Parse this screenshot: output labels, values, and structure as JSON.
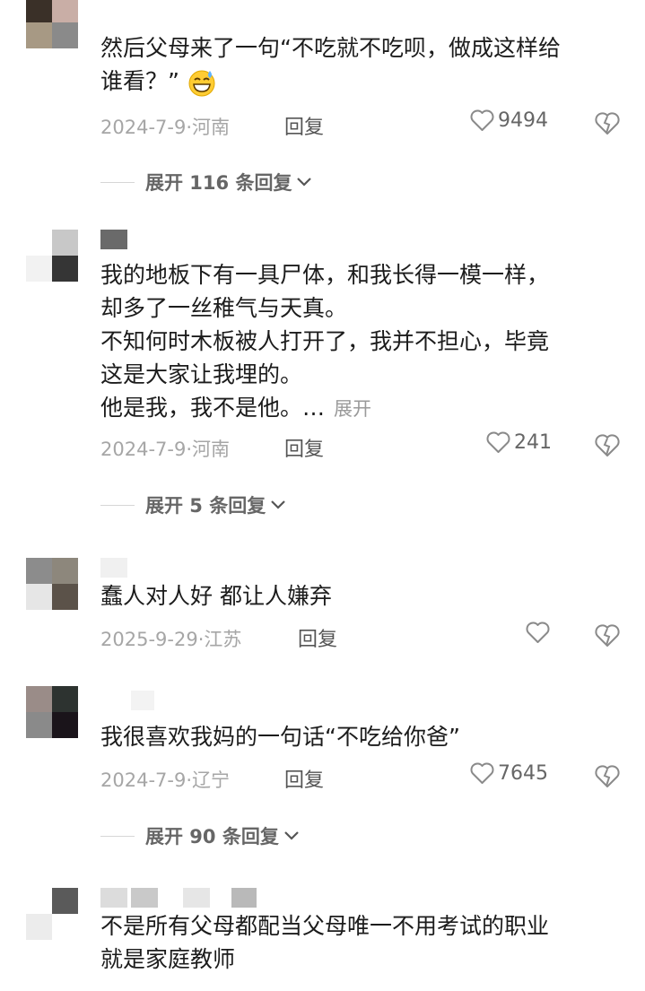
{
  "comments": [
    {
      "text_lines": [
        "然后父母来了一句“不吃就不吃呗，做成这样给",
        "谁看？”"
      ],
      "has_emoji": true,
      "date": "2024-7-9",
      "location": "河南",
      "reply_label": "回复",
      "likes": "9494",
      "replies_label": "展开 116 条回复"
    },
    {
      "text_lines": [
        "我的地板下有一具尸体，和我长得一模一样，",
        "却多了一丝稚气与天真。",
        "不知何时木板被人打开了，我并不担心，毕竟",
        "这是大家让我埋的。",
        "他是我，我不是他。…"
      ],
      "expand_label": "展开",
      "date": "2024-7-9",
      "location": "河南",
      "reply_label": "回复",
      "likes": "241",
      "replies_label": "展开 5 条回复"
    },
    {
      "text_lines": [
        "蠢人对人好  都让人嫌弃"
      ],
      "date": "2025-9-29",
      "location": "江苏",
      "reply_label": "回复",
      "likes": ""
    },
    {
      "text_lines": [
        "我很喜欢我妈的一句话“不吃给你爸”"
      ],
      "date": "2024-7-9",
      "location": "辽宁",
      "reply_label": "回复",
      "likes": "7645",
      "replies_label": "展开 90 条回复"
    },
    {
      "text_lines": [
        "不是所有父母都配当父母唯一不用考试的职业",
        "就是家庭教师"
      ]
    }
  ],
  "colors": {
    "text": "#1c1c1c",
    "meta": "#a6a6a6",
    "reply": "#555555",
    "icon": "#8a8a8a"
  },
  "icons": {
    "like": "heart-outline-icon",
    "dislike": "broken-heart-icon",
    "expand": "chevron-down-icon"
  }
}
